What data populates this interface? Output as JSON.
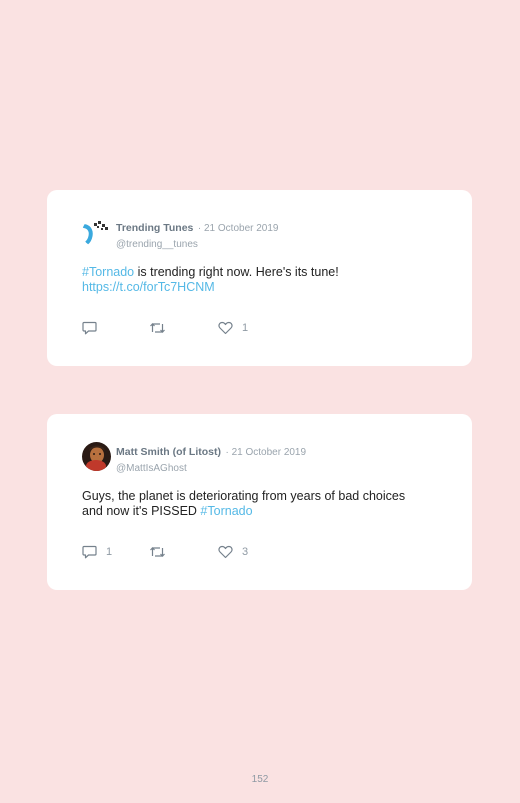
{
  "tweets": [
    {
      "name": "Trending Tunes",
      "separator": "·",
      "date": "21 October 2019",
      "handle": "@trending__tunes",
      "text_parts": [
        "#Tornado",
        " is trending right now. Here's its tune!",
        "https://t.co/forTc7HCNM"
      ],
      "replies": "",
      "retweets": "",
      "likes": "1"
    },
    {
      "name": "Matt Smith (of Litost)",
      "separator": "·",
      "date": "21 October 2019",
      "handle": "@MattIsAGhost",
      "text_parts": [
        "Guys, the planet is deteriorating from years of bad choices and now it's PISSED ",
        "#Tornado"
      ],
      "replies": "1",
      "retweets": "",
      "likes": "3"
    }
  ],
  "page_number": "152",
  "colors": {
    "background": "#fae2e2",
    "link": "#55b9e6",
    "card": "#ffffff"
  },
  "icons": [
    "reply-icon",
    "retweet-icon",
    "like-icon"
  ]
}
